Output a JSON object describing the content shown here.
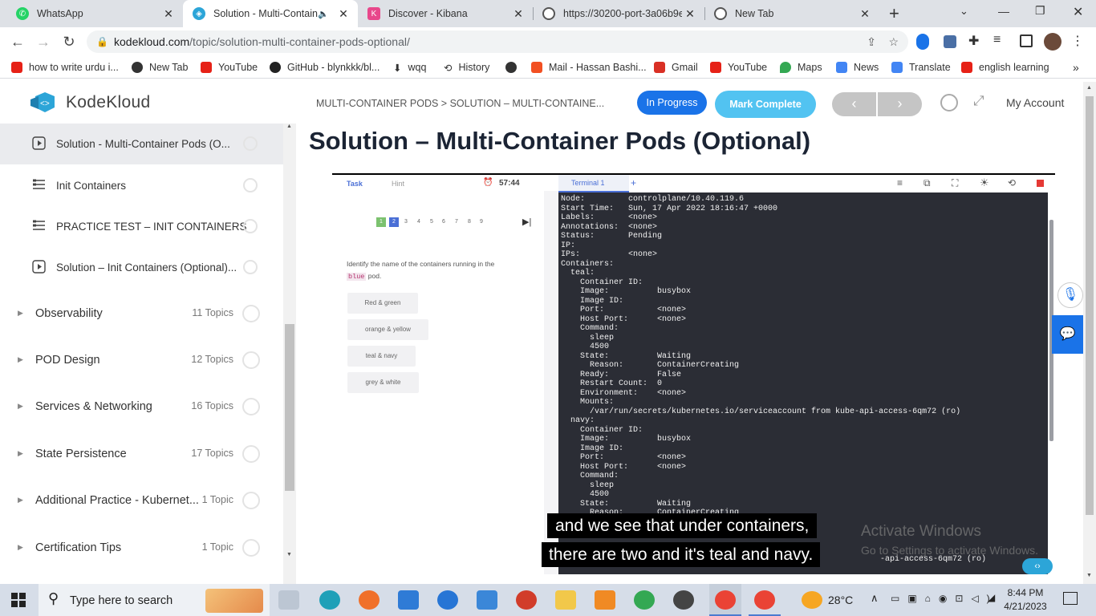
{
  "browser": {
    "tabs": [
      {
        "title": "WhatsApp",
        "color": "#25d366"
      },
      {
        "title": "Solution - Multi-Contain",
        "color": "#2ca5d8",
        "active": true
      },
      {
        "title": "Discover - Kibana",
        "color": "#e8478b"
      },
      {
        "title": "https://30200-port-3a06b9e",
        "color": "#555"
      },
      {
        "title": "New Tab",
        "color": "#555"
      }
    ],
    "url_host": "kodekloud.com",
    "url_path": "/topic/solution-multi-container-pods-optional/",
    "bookmarks": [
      {
        "label": "how to write urdu i...",
        "color": "#e62117"
      },
      {
        "label": "New Tab",
        "color": "#333"
      },
      {
        "label": "YouTube",
        "color": "#e62117"
      },
      {
        "label": "GitHub - blynkkk/bl...",
        "color": "#222"
      },
      {
        "label": "wqq",
        "color": "#555"
      },
      {
        "label": "History",
        "color": "#555"
      },
      {
        "label": "",
        "color": "#555"
      },
      {
        "label": "Mail - Hassan Bashi...",
        "color": "#f25022"
      },
      {
        "label": "Gmail",
        "color": "#d93025"
      },
      {
        "label": "YouTube",
        "color": "#e62117"
      },
      {
        "label": "Maps",
        "color": "#34a853"
      },
      {
        "label": "News",
        "color": "#4285f4"
      },
      {
        "label": "Translate",
        "color": "#4285f4"
      },
      {
        "label": "english learning",
        "color": "#e62117"
      }
    ]
  },
  "header": {
    "logo_text": "KodeKloud",
    "breadcrumb": "MULTI-CONTAINER PODS > SOLUTION – MULTI-CONTAINE...",
    "status_label": "In Progress",
    "complete_label": "Mark Complete",
    "prev_glyph": "‹",
    "next_glyph": "›",
    "account_label": "My Account"
  },
  "sidebar": {
    "lessons": [
      {
        "title": "Solution - Multi-Container Pods (O...",
        "icon": "play-icon",
        "active": true
      },
      {
        "title": "Init Containers",
        "icon": "list-icon"
      },
      {
        "title": "PRACTICE TEST – INIT CONTAINERS",
        "icon": "list-icon"
      },
      {
        "title": "Solution – Init Containers (Optional)...",
        "icon": "play-icon"
      }
    ],
    "modules": [
      {
        "title": "Observability",
        "count": "11 Topics"
      },
      {
        "title": "POD Design",
        "count": "12 Topics"
      },
      {
        "title": "Services & Networking",
        "count": "16 Topics"
      },
      {
        "title": "State Persistence",
        "count": "17 Topics"
      },
      {
        "title": "Additional Practice - Kubernet...",
        "count": "1 Topic"
      },
      {
        "title": "Certification Tips",
        "count": "1 Topic"
      }
    ]
  },
  "main": {
    "title": "Solution – Multi-Container Pods (Optional)",
    "quiz": {
      "task_tab": "Task",
      "hint_tab": "Hint",
      "timer": "57:44",
      "pages": [
        "1",
        "2",
        "3",
        "4",
        "5",
        "6",
        "7",
        "8",
        "9"
      ],
      "question_pre": "Identify the name of the containers running in the",
      "question_code": "blue",
      "question_post": "pod.",
      "answers": [
        "Red & green",
        "orange & yellow",
        "teal & navy",
        "grey & white"
      ]
    },
    "terminal": {
      "tab_label": "Terminal 1",
      "add_label": "+",
      "text": "Node:         controlplane/10.40.119.6\nStart Time:   Sun, 17 Apr 2022 18:16:47 +0000\nLabels:       <none>\nAnnotations:  <none>\nStatus:       Pending\nIP:\nIPs:          <none>\nContainers:\n  teal:\n    Container ID:\n    Image:          busybox\n    Image ID:\n    Port:           <none>\n    Host Port:      <none>\n    Command:\n      sleep\n      4500\n    State:          Waiting\n      Reason:       ContainerCreating\n    Ready:          False\n    Restart Count:  0\n    Environment:    <none>\n    Mounts:\n      /var/run/secrets/kubernetes.io/serviceaccount from kube-api-access-6qm72 (ro)\n  navy:\n    Container ID:\n    Image:          busybox\n    Image ID:\n    Port:           <none>\n    Host Port:      <none>\n    Command:\n      sleep\n      4500\n    State:          Waiting\n      Reason:       ContainerCreating",
      "bottom_line": "-api-access-6qm72 (ro)"
    },
    "caption_line1": "and we see that under containers,",
    "caption_line2": "there are two and it's teal and navy."
  },
  "watermark": {
    "title": "Activate Windows",
    "subtitle": "Go to Settings to activate Windows."
  },
  "taskbar": {
    "search_placeholder": "Type here to search",
    "temperature": "28°C",
    "time": "8:44 PM",
    "date": "4/21/2023"
  }
}
